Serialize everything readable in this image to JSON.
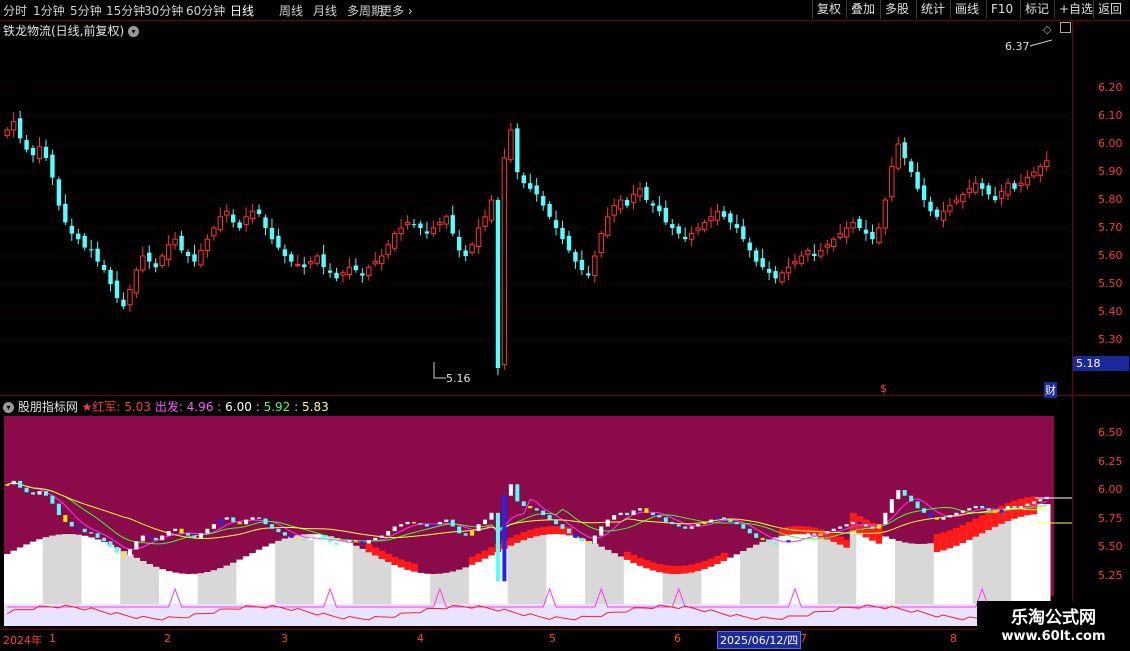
{
  "toolbar": {
    "timeframes": [
      "分时",
      "1分钟",
      "5分钟",
      "15分钟",
      "30分钟",
      "60分钟",
      "日线",
      "周线",
      "月线",
      "多周期",
      "更多"
    ],
    "active_timeframe": "日线",
    "right_buttons": [
      "复权",
      "叠加",
      "多股",
      "统计",
      "画线",
      "F10",
      "标记",
      "+自选",
      "返回"
    ]
  },
  "main_panel": {
    "title": "铁龙物流(日线,前复权)",
    "y_ticks": [
      "6.20",
      "6.10",
      "6.00",
      "5.90",
      "5.80",
      "5.70",
      "5.60",
      "5.50",
      "5.40",
      "5.30"
    ],
    "high_label": "6.37",
    "low_label": "5.16",
    "last_price": "5.18",
    "marker_dollar": "$",
    "marker_cai": "财"
  },
  "indicator_panel": {
    "name": "股朋指标网",
    "star_label": "★红军:",
    "star_value": "5.03",
    "chufa_label": "出发:",
    "v1": "4.96",
    "v2": "6.00",
    "v3": "5.92",
    "v4": "5.83",
    "y_ticks": [
      "6.50",
      "6.25",
      "6.00",
      "5.75",
      "5.50",
      "5.25"
    ]
  },
  "date_axis": {
    "year_label": "2024年",
    "months": [
      "1",
      "2",
      "3",
      "4",
      "5",
      "6",
      "7",
      "8"
    ],
    "cursor_date": "2025/06/12/四"
  },
  "watermark": {
    "line1": "乐淘公式网",
    "line2": "www.60lt.com"
  },
  "colors": {
    "up": "#ff3333",
    "down": "#54ffff",
    "indicator_bg": "#8b0a4a",
    "axis_text": "#ff3b3b"
  },
  "chart_data": {
    "type": "candlestick",
    "ylim": [
      5.16,
      6.37
    ],
    "closes": [
      6.05,
      6.08,
      6.02,
      5.98,
      5.96,
      5.99,
      5.95,
      5.88,
      5.78,
      5.72,
      5.68,
      5.66,
      5.63,
      5.62,
      5.58,
      5.55,
      5.5,
      5.45,
      5.42,
      5.48,
      5.55,
      5.6,
      5.58,
      5.56,
      5.6,
      5.64,
      5.66,
      5.62,
      5.6,
      5.58,
      5.62,
      5.66,
      5.7,
      5.74,
      5.76,
      5.72,
      5.7,
      5.74,
      5.76,
      5.75,
      5.7,
      5.66,
      5.63,
      5.6,
      5.58,
      5.57,
      5.56,
      5.58,
      5.6,
      5.56,
      5.54,
      5.52,
      5.54,
      5.56,
      5.55,
      5.53,
      5.56,
      5.58,
      5.6,
      5.64,
      5.68,
      5.7,
      5.72,
      5.71,
      5.7,
      5.68,
      5.7,
      5.72,
      5.74,
      5.68,
      5.62,
      5.6,
      5.64,
      5.7,
      5.74,
      5.8,
      5.2,
      5.95,
      6.05,
      5.9,
      5.86,
      5.84,
      5.82,
      5.78,
      5.74,
      5.7,
      5.66,
      5.62,
      5.58,
      5.55,
      5.53,
      5.6,
      5.68,
      5.74,
      5.78,
      5.8,
      5.78,
      5.82,
      5.84,
      5.8,
      5.78,
      5.76,
      5.72,
      5.7,
      5.68,
      5.66,
      5.68,
      5.7,
      5.72,
      5.74,
      5.76,
      5.74,
      5.72,
      5.7,
      5.66,
      5.62,
      5.58,
      5.56,
      5.54,
      5.52,
      5.54,
      5.56,
      5.58,
      5.6,
      5.62,
      5.6,
      5.62,
      5.64,
      5.66,
      5.68,
      5.7,
      5.72,
      5.7,
      5.68,
      5.66,
      5.7,
      5.8,
      5.92,
      6.0,
      5.95,
      5.9,
      5.84,
      5.8,
      5.76,
      5.74,
      5.76,
      5.78,
      5.8,
      5.82,
      5.84,
      5.86,
      5.84,
      5.82,
      5.8,
      5.83,
      5.86,
      5.84,
      5.86,
      5.88,
      5.9,
      5.92,
      5.94
    ]
  }
}
